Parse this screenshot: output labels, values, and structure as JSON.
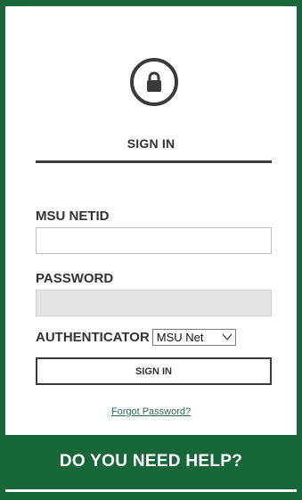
{
  "header": {
    "title": "SIGN IN",
    "icon": "lock-icon"
  },
  "form": {
    "netid_label": "MSU NETID",
    "netid_value": "",
    "password_label": "PASSWORD",
    "password_value": "",
    "authenticator_label": "AUTHENTICATOR",
    "authenticator_selected": "MSU Net",
    "signin_button": "SIGN IN",
    "forgot_link": "Forgot Password?"
  },
  "help": {
    "label": "DO YOU NEED HELP?"
  },
  "colors": {
    "brand_green": "#18673a",
    "text": "#333333",
    "link": "#2a6a5a"
  }
}
